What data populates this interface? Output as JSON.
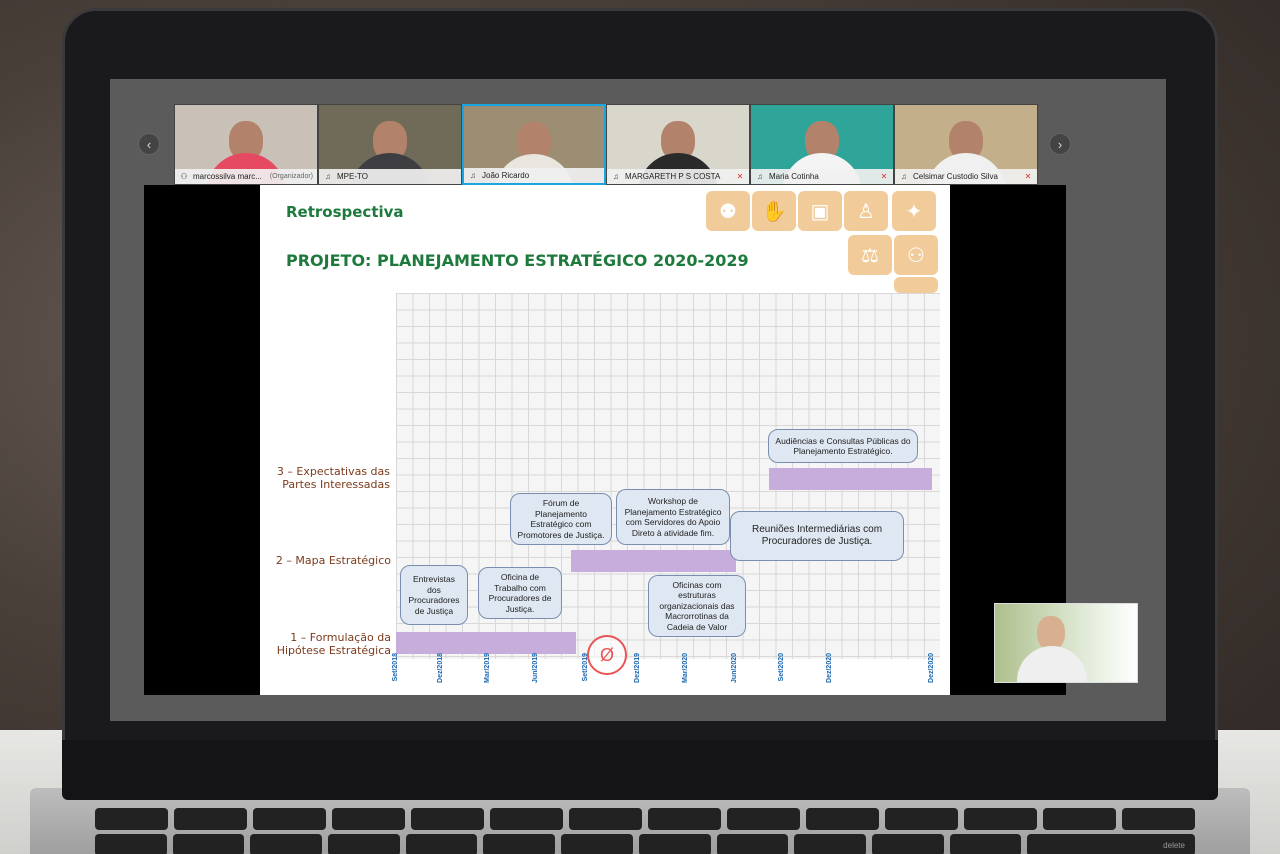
{
  "meeting": {
    "participants": [
      {
        "name": "marcossilva marc...",
        "role": "(Organizador)",
        "mic": "on",
        "active": false,
        "colors": {
          "bg": "#c9c1b8",
          "body": "#e64a63"
        }
      },
      {
        "name": "MPE-TO",
        "role": "",
        "mic": "on",
        "active": false,
        "colors": {
          "bg": "#6f6b58",
          "body": "#3d3d42"
        }
      },
      {
        "name": "João Ricardo",
        "role": "",
        "mic": "on",
        "active": true,
        "colors": {
          "bg": "#9d8e73",
          "body": "#e9e5df"
        }
      },
      {
        "name": "MARGARETH P S COSTA",
        "role": "",
        "mic": "off",
        "active": false,
        "colors": {
          "bg": "#d9d6cc",
          "body": "#2a2a2a"
        }
      },
      {
        "name": "Maria Cotinha",
        "role": "",
        "mic": "off",
        "active": false,
        "colors": {
          "bg": "#2fa59a",
          "body": "#f4f4f4"
        }
      },
      {
        "name": "Celsimar Custodio Silva",
        "role": "",
        "mic": "off",
        "active": false,
        "colors": {
          "bg": "#c3b08a",
          "body": "#f0f0f0"
        }
      }
    ]
  },
  "slide": {
    "title": "Retrospectiva",
    "subtitle": "PROJETO: PLANEJAMENTO ESTRATÉGICO 2020-2029"
  },
  "gantt": {
    "rows": [
      {
        "label_line1": "3 – Expectativas das",
        "label_line2": "Partes Interessadas"
      },
      {
        "label_line1": "2 – Mapa Estratégico",
        "label_line2": ""
      },
      {
        "label_line1": "1 – Formulação da",
        "label_line2": "Hipótese Estratégica"
      }
    ],
    "ticks": [
      "Set/2018",
      "Dez/2018",
      "Mar/2019",
      "Jun/2019",
      "Set/2019",
      "Dez/2019",
      "Mar/2020",
      "Jun/2020",
      "Set/2020",
      "Dez/2020",
      "Dez/2020"
    ],
    "callouts": {
      "c1": "Entrevistas dos Procuradores de Justiça",
      "c2": "Oficina de Trabalho com Procuradores de Justiça.",
      "c3": "Fórum de Planejamento Estratégico com Promotores de Justiça.",
      "c4": "Workshop de Planejamento Estratégico com Servidores do Apoio Direto à atividade fim.",
      "c5": "Reuniões Intermediárias com Procuradores de Justiça.",
      "c6": "Oficinas com estruturas organizacionais das Macrorrotinas da Cadeia de Valor",
      "c7": "Audiências e Consultas Públicas do Planejamento Estratégico."
    }
  },
  "colors": {
    "accent": "#1d7a3c",
    "bar": "#c6addb",
    "active_border": "#19a6e0"
  },
  "keyboard": {
    "delete": "delete"
  }
}
